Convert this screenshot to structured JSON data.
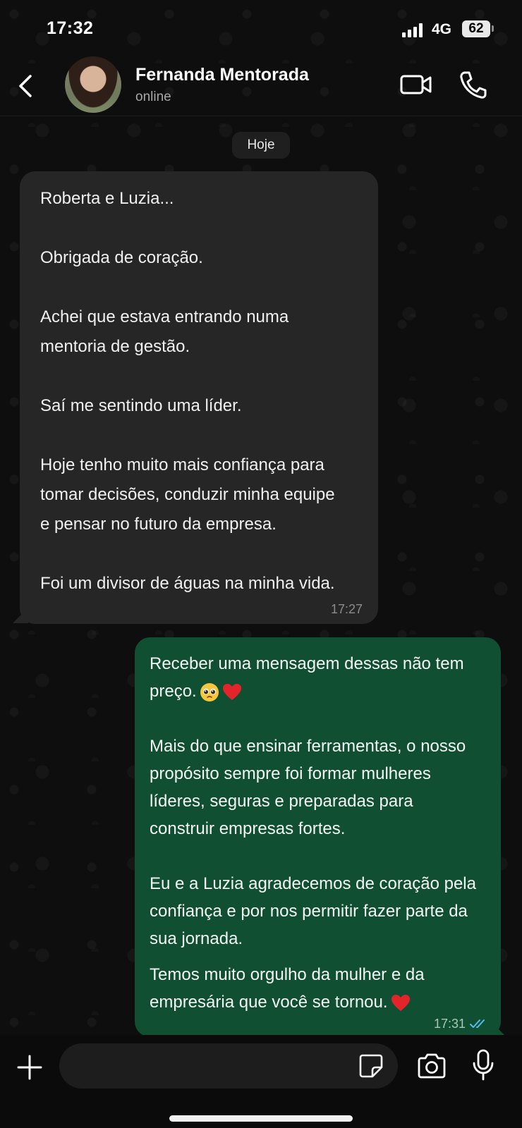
{
  "status_bar": {
    "time": "17:32",
    "network": "4G",
    "battery": "62"
  },
  "header": {
    "contact_name": "Fernanda Mentorada",
    "contact_status": "online"
  },
  "date_chip": "Hoje",
  "messages": [
    {
      "direction": "incoming",
      "paragraphs": [
        [
          "Roberta e Luzia..."
        ],
        [
          "Obrigada de coração."
        ],
        [
          "Achei que estava entrando numa",
          "mentoria de gestão."
        ],
        [
          "Saí me sentindo uma líder."
        ],
        [
          "Hoje tenho muito mais confiança para",
          "tomar decisões, conduzir minha equipe",
          "e pensar no futuro da empresa."
        ],
        [
          "Foi um divisor de águas na minha vida."
        ]
      ],
      "time": "17:27"
    },
    {
      "direction": "outgoing",
      "paragraphs": [
        [
          "Receber uma mensagem dessas não tem",
          "preço."
        ],
        [
          "Mais do que ensinar ferramentas, o nosso",
          "propósito sempre foi formar mulheres",
          "líderes, seguras e preparadas para",
          "construir empresas fortes."
        ],
        [
          "Eu e a Luzia agradecemos de coração pela",
          "confiança e por nos permitir fazer parte da",
          "sua jornada."
        ],
        [
          "Temos muito orgulho da mulher e da",
          "empresária que você se tornou."
        ]
      ],
      "time": "17:31",
      "read_receipt": "double-check-blue",
      "emojis": [
        "pleading-face",
        "red-heart",
        "red-heart"
      ]
    }
  ],
  "input": {
    "placeholder": ""
  },
  "colors": {
    "incoming_bubble": "#262626",
    "outgoing_bubble": "#114f33",
    "read_check": "#53bdeb"
  }
}
